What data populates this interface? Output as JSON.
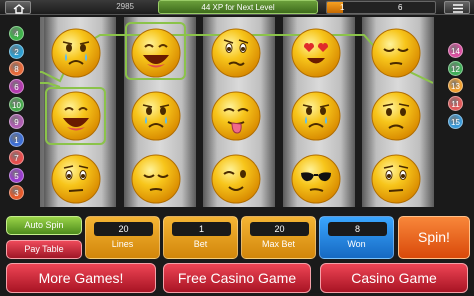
{
  "topbar": {
    "coins": "2985",
    "xp_message": "44 XP for Next Level",
    "level": "1",
    "xp": "6",
    "level_progress": 0.15
  },
  "left_lines": [
    "4",
    "2",
    "8",
    "6",
    "10",
    "9",
    "1",
    "7",
    "5",
    "3"
  ],
  "right_lines": [
    "14",
    "12",
    "13",
    "11",
    "15"
  ],
  "left_lines_bottom": [
    "10",
    "9",
    "1",
    "7",
    "5",
    "3"
  ],
  "controls": {
    "auto_spin": "Auto Spin",
    "pay_table": "Pay Table",
    "lines_value": "20",
    "lines_label": "Lines",
    "bet_value": "1",
    "bet_label": "Bet",
    "max_bet_value": "20",
    "max_bet_label": "Max Bet",
    "won_value": "8",
    "won_label": "Won",
    "spin": "Spin!"
  },
  "bottom": {
    "more_games": "More Games!",
    "free_casino": "Free Casino Game",
    "casino_game": "Casino Game"
  },
  "colors": {
    "accent": "#8bc34a",
    "orange": "#f5b535",
    "blue": "#3aa6ff",
    "red": "#ee4555"
  },
  "reels": [
    [
      "crying-emoji",
      "laughing-emoji",
      "worried-emoji"
    ],
    [
      "laughing-emoji",
      "crying-emoji",
      "sleepy-emoji"
    ],
    [
      "confused-emoji",
      "tongue-emoji",
      "wink-emoji"
    ],
    [
      "heart-eyes-emoji",
      "crying-emoji",
      "sunglasses-emoji"
    ],
    [
      "sleepy-emoji",
      "frowning-emoji",
      "worried-emoji"
    ]
  ]
}
